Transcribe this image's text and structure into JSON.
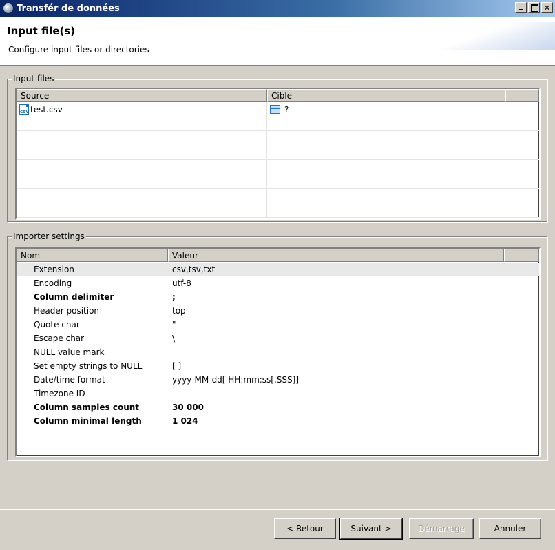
{
  "window": {
    "title": "Transfér de données"
  },
  "header": {
    "title": "Input file(s)",
    "description": "Configure input files or directories"
  },
  "input_files": {
    "group_label": "Input files",
    "columns": [
      "Source",
      "Cible"
    ],
    "rows": [
      {
        "source": "test.csv",
        "source_icon": "csv-file-icon",
        "target": "?",
        "target_icon": "table-icon"
      }
    ],
    "icon_text": "csv"
  },
  "importer_settings": {
    "group_label": "Importer settings",
    "columns": [
      "Nom",
      "Valeur"
    ],
    "rows": [
      {
        "name": "Extension",
        "value": "csv,tsv,txt",
        "bold": false,
        "selected": true
      },
      {
        "name": "Encoding",
        "value": "utf-8",
        "bold": false
      },
      {
        "name": "Column delimiter",
        "value": ";",
        "bold": true
      },
      {
        "name": "Header position",
        "value": "top",
        "bold": false
      },
      {
        "name": "Quote char",
        "value": "\"",
        "bold": false
      },
      {
        "name": "Escape char",
        "value": "\\",
        "bold": false
      },
      {
        "name": "NULL value mark",
        "value": "",
        "bold": false
      },
      {
        "name": "Set empty strings to NULL",
        "value": "[ ]",
        "bold": false
      },
      {
        "name": "Date/time format",
        "value": "yyyy-MM-dd[ HH:mm:ss[.SSS]]",
        "bold": false
      },
      {
        "name": "Timezone ID",
        "value": "",
        "bold": false
      },
      {
        "name": "Column samples count",
        "value": "30 000",
        "bold": true
      },
      {
        "name": "Column minimal length",
        "value": "1 024",
        "bold": true
      }
    ]
  },
  "buttons": {
    "back": "< Retour",
    "next": "Suivant >",
    "start": "Démarrage",
    "cancel": "Annuler"
  }
}
